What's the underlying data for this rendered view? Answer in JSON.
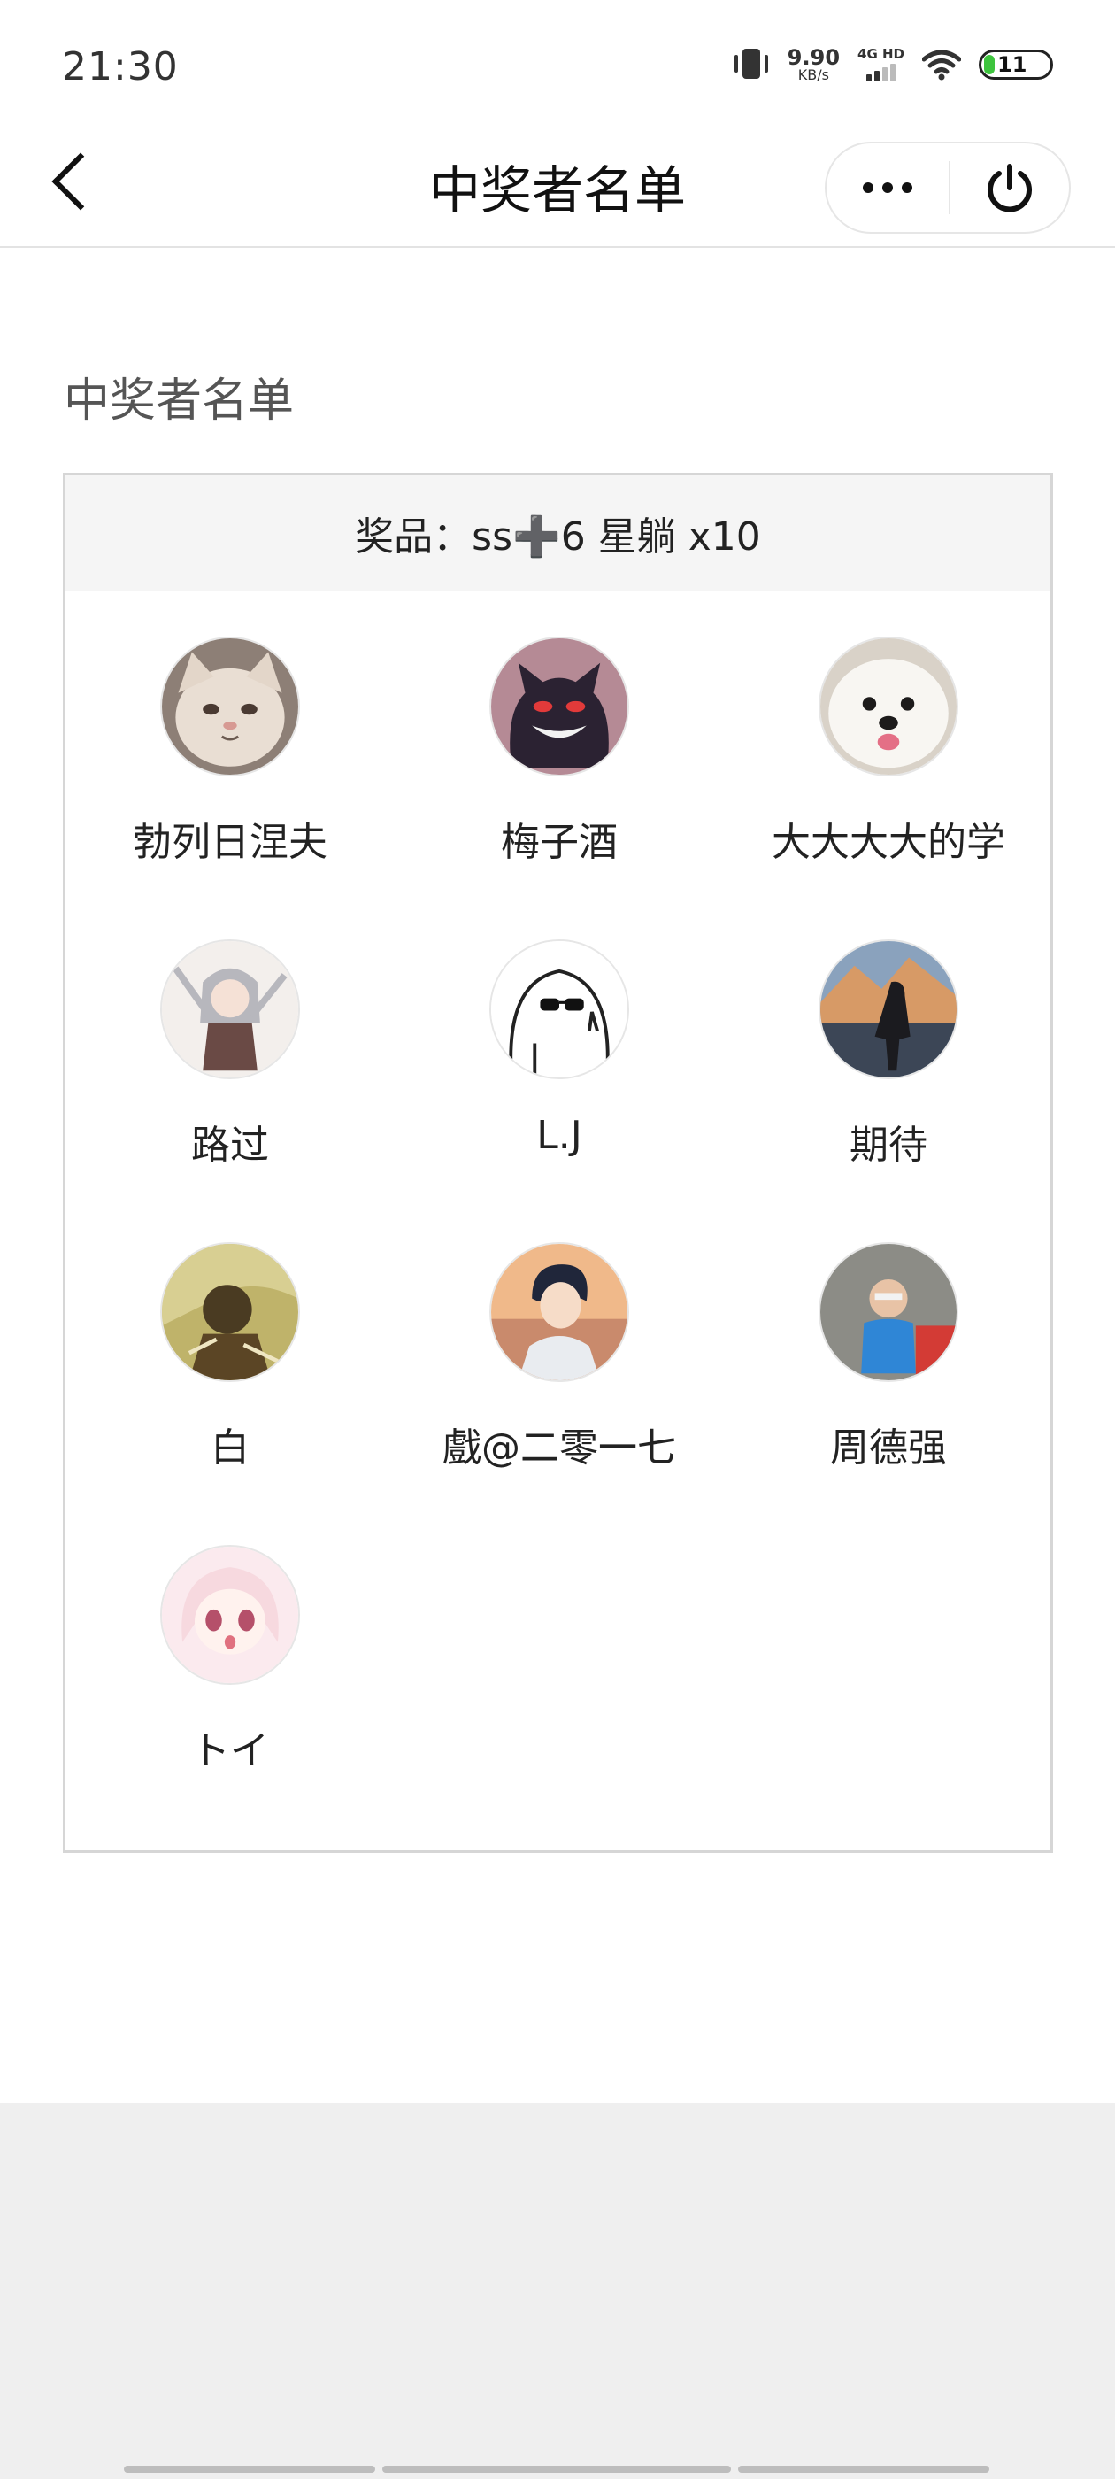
{
  "status": {
    "time": "21:30",
    "speed_value": "9.90",
    "speed_unit": "KB/s",
    "network_type": "4G HD",
    "battery": "11",
    "battery_color": "#3ec43e"
  },
  "nav": {
    "title": "中奖者名单",
    "more_icon": "more-dots-icon",
    "power_icon": "power-icon"
  },
  "page": {
    "section_title": "中奖者名单",
    "prize_label": "奖品：ss➕6 星躺 x10"
  },
  "winners": [
    {
      "name": "勃列日涅夫",
      "avatar": "cat-avatar"
    },
    {
      "name": "梅子酒",
      "avatar": "ghost-monster-avatar"
    },
    {
      "name": "大大大大的学",
      "avatar": "white-dog-avatar"
    },
    {
      "name": "路过",
      "avatar": "anime-girl-avatar"
    },
    {
      "name": "L.J",
      "avatar": "sunglasses-meme-avatar"
    },
    {
      "name": "期待",
      "avatar": "mountain-hiker-avatar"
    },
    {
      "name": "白",
      "avatar": "dark-anime-avatar"
    },
    {
      "name": "戲@二零一七",
      "avatar": "anime-boy-avatar"
    },
    {
      "name": "周德强",
      "avatar": "child-photo-avatar"
    },
    {
      "name": "トイ",
      "avatar": "pink-anime-girl-avatar"
    }
  ]
}
